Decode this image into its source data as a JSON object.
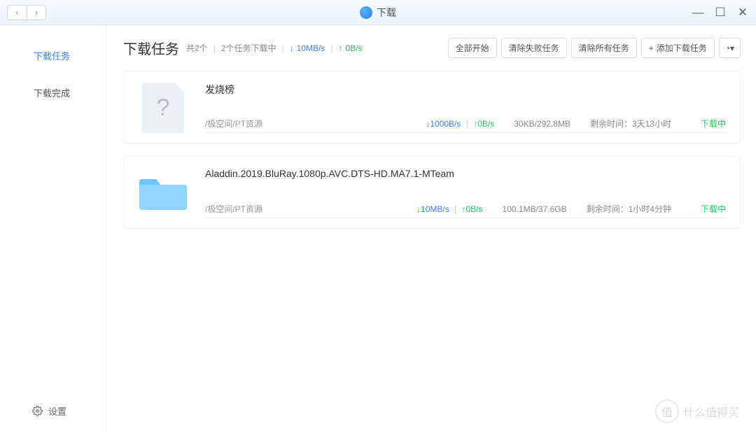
{
  "titlebar": {
    "title": "下载"
  },
  "sidebar": {
    "tasks": "下载任务",
    "completed": "下载完成",
    "settings": "设置"
  },
  "header": {
    "title": "下载任务",
    "total_label": "共2个",
    "active_label": "2个任务下载中",
    "down_speed": "10MB/s",
    "up_speed": "0B/s"
  },
  "toolbar": {
    "start_all": "全部开始",
    "clear_failed": "清除失败任务",
    "clear_all": "清除所有任务",
    "add_task": "添加下载任务"
  },
  "tasks": [
    {
      "name": "发烧榜",
      "path": "/极空间/PT资源",
      "down_speed": "1000B/s",
      "up_speed": "0B/s",
      "size": "30KB/292.8MB",
      "eta_label": "剩余时间：",
      "eta": "3天13小时",
      "status": "下载中",
      "thumb": "unknown"
    },
    {
      "name": "Aladdin.2019.BluRay.1080p.AVC.DTS-HD.MA7.1-MTeam",
      "path": "/极空间/PT资源",
      "down_speed": "10MB/s",
      "up_speed": "0B/s",
      "size": "100.1MB/37.6GB",
      "eta_label": "剩余时间：",
      "eta": "1小时4分钟",
      "status": "下载中",
      "thumb": "folder"
    }
  ],
  "watermark": {
    "badge": "值",
    "text": "什么值得买"
  }
}
